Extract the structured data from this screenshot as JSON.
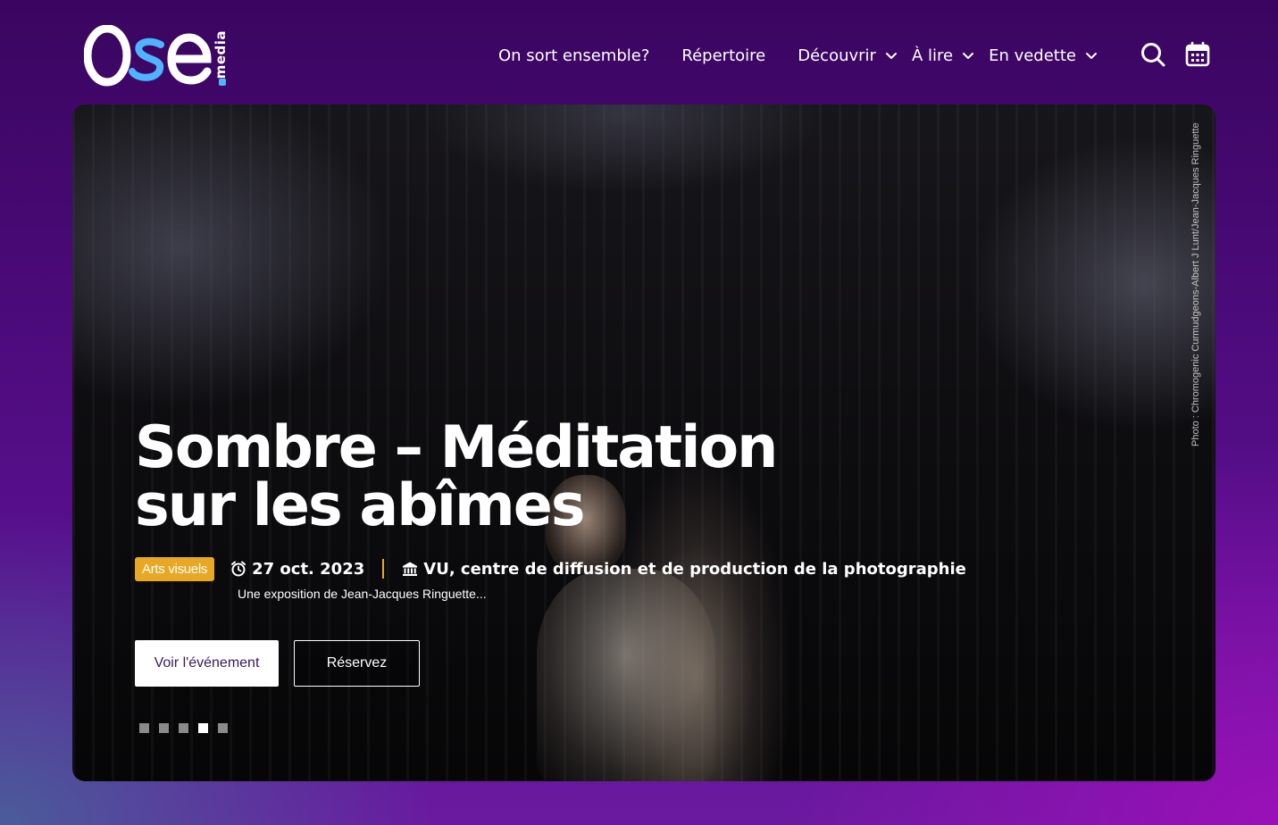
{
  "brand": {
    "logo_text": "Ose",
    "logo_suffix": "media",
    "accent_color": "#4fb4ff",
    "background_colors": [
      "#3a0560",
      "#9a10b8",
      "#4a5c9a"
    ]
  },
  "nav": {
    "items": [
      {
        "label": "On sort ensemble?",
        "has_dropdown": false
      },
      {
        "label": "Répertoire",
        "has_dropdown": false
      },
      {
        "label": "Découvrir",
        "has_dropdown": true
      },
      {
        "label": "À lire",
        "has_dropdown": true
      },
      {
        "label": "En vedette",
        "has_dropdown": true
      }
    ],
    "icons": [
      "search-icon",
      "calendar-icon"
    ]
  },
  "hero": {
    "title_line1": "Sombre – Méditation",
    "title_line2": "sur les abîmes",
    "category": "Arts visuels",
    "category_color": "#e8a824",
    "date": "27 oct. 2023",
    "venue": "VU, centre de diffusion et de production de la photographie",
    "description": "Une exposition de Jean-Jacques Ringuette...",
    "primary_button": "Voir l'événement",
    "secondary_button": "Réservez",
    "photo_credit": "Photo : Chromogenic Curmudgeons-Albert J Lunt/Jean-Jacques Ringuette",
    "slides_total": 5,
    "active_slide": 4
  }
}
